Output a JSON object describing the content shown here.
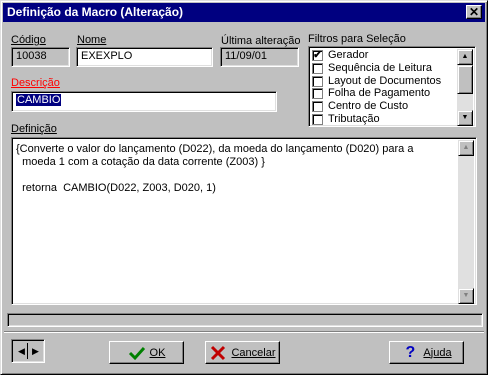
{
  "window": {
    "title": "Definição da Macro (Alteração)"
  },
  "fields": {
    "codigo": {
      "label": "Código",
      "value": "10038"
    },
    "nome": {
      "label": "Nome",
      "value": "EXEXPLO"
    },
    "ultima": {
      "label": "Última alteração",
      "value": "11/09/01"
    },
    "descricao": {
      "label": "Descrição",
      "value": "CAMBIO"
    }
  },
  "filtros": {
    "label": "Filtros para Seleção",
    "items": [
      {
        "label": "Gerador",
        "checked": true
      },
      {
        "label": "Sequência de Leitura",
        "checked": false
      },
      {
        "label": "Layout de Documentos",
        "checked": false
      },
      {
        "label": "Folha de Pagamento",
        "checked": false
      },
      {
        "label": "Centro de Custo",
        "checked": false
      },
      {
        "label": "Tributação",
        "checked": false
      }
    ]
  },
  "definicao": {
    "label": "Definição",
    "lines": [
      "{Converte o valor do lançamento (D022), da moeda do lançamento (D020) para a",
      "  moeda 1 com a cotação da data corrente (Z003) }",
      "",
      "  retorna  CAMBIO(D022, Z003, D020, 1)"
    ]
  },
  "buttons": {
    "nav_left": "◀",
    "nav_right": "▶",
    "ok_label": "OK",
    "cancel_label": "Cancelar",
    "help_label": "Ajuda",
    "close": "✕"
  },
  "icons": {
    "ok": "green-check-icon",
    "cancel": "red-x-icon",
    "help": "question-mark-icon"
  },
  "colors": {
    "titlebar": "#000080",
    "descricao_label": "#ff0000",
    "face": "#c0c0c0"
  }
}
